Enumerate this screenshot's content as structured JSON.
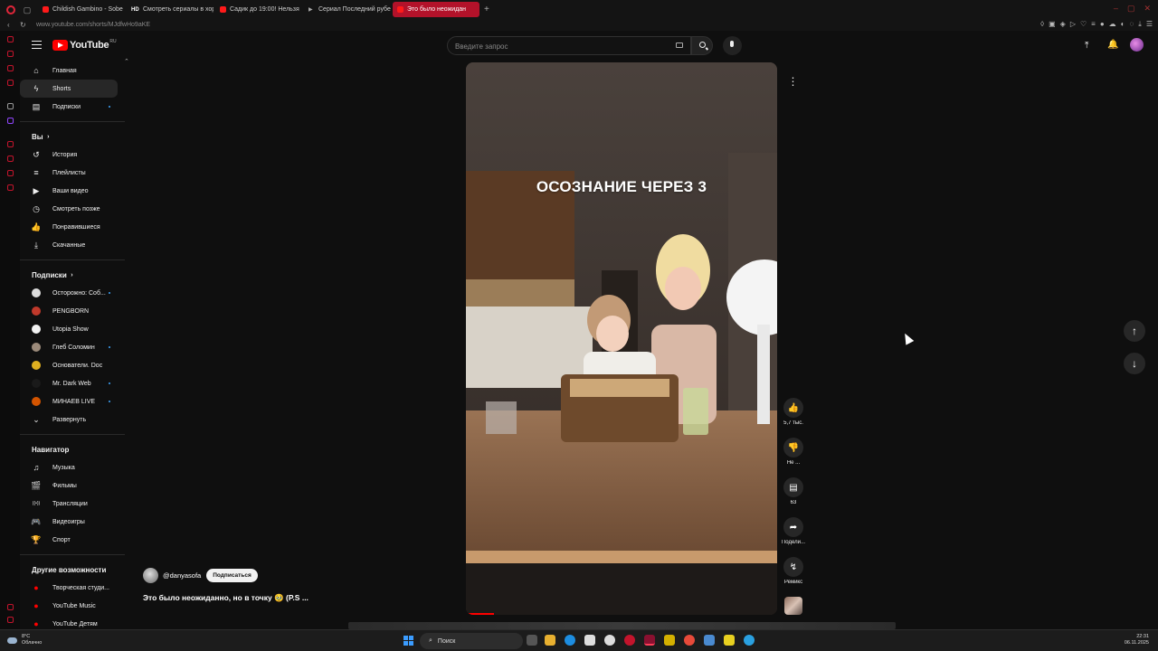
{
  "browser": {
    "tabs": [
      {
        "label": "Childish Gambino - Sobe",
        "fav": "yt"
      },
      {
        "label": "Смотреть сериалы в хор",
        "fav": "hd"
      },
      {
        "label": "Садик до 19:00! Нельзя",
        "fav": "yt"
      },
      {
        "label": "Сериал Последний рубе",
        "fav": "p"
      },
      {
        "label": "Это было неожидан",
        "fav": "yt",
        "active": true
      }
    ],
    "url": "www.youtube.com/shorts/MJdfwHo9aKE"
  },
  "header": {
    "logo_text": "YouTube",
    "logo_region": "RU",
    "search_placeholder": "Введите запрос"
  },
  "sidebar": {
    "main": [
      {
        "label": "Главная",
        "icon": "home-icon",
        "glyph": "⌂"
      },
      {
        "label": "Shorts",
        "icon": "shorts-icon",
        "glyph": "ϟ",
        "active": true
      },
      {
        "label": "Подписки",
        "icon": "subscriptions-icon",
        "glyph": "▤",
        "dot": true
      }
    ],
    "you_heading": "Вы",
    "you": [
      {
        "label": "История",
        "icon": "history-icon",
        "glyph": "↺"
      },
      {
        "label": "Плейлисты",
        "icon": "playlists-icon",
        "glyph": "≡"
      },
      {
        "label": "Ваши видео",
        "icon": "your-videos-icon",
        "glyph": "▶"
      },
      {
        "label": "Смотреть позже",
        "icon": "watch-later-icon",
        "glyph": "◷"
      },
      {
        "label": "Понравившиеся",
        "icon": "liked-icon",
        "glyph": "👍"
      },
      {
        "label": "Скачанные",
        "icon": "downloads-icon",
        "glyph": "⤓"
      }
    ],
    "subs_heading": "Подписки",
    "subs": [
      {
        "label": "Осторожно: Соб...",
        "color": "#dddddd",
        "dot": true
      },
      {
        "label": "PENGBORN",
        "color": "#c0392b",
        "dot": false
      },
      {
        "label": "Utopia Show",
        "color": "#f2f2f2",
        "dot": false
      },
      {
        "label": "Глеб Соломин",
        "color": "#9b8a7a",
        "dot": true
      },
      {
        "label": "Основатели. Doc",
        "color": "#e0b020",
        "dot": false
      },
      {
        "label": "Mr. Dark Web",
        "color": "#1a1a1a",
        "dot": true
      },
      {
        "label": "МИНАЕВ LIVE",
        "color": "#d35400",
        "dot": true
      }
    ],
    "expand_label": "Развернуть",
    "nav_heading": "Навигатор",
    "nav": [
      {
        "label": "Музыка",
        "icon": "music-icon",
        "glyph": "♫"
      },
      {
        "label": "Фильмы",
        "icon": "movies-icon",
        "glyph": "🎬"
      },
      {
        "label": "Трансляции",
        "icon": "live-icon",
        "glyph": "((•))"
      },
      {
        "label": "Видеоигры",
        "icon": "gaming-icon",
        "glyph": "🎮"
      },
      {
        "label": "Спорт",
        "icon": "sport-icon",
        "glyph": "🏆"
      }
    ],
    "more_heading": "Другие возможности",
    "more": [
      {
        "label": "Творческая студи...",
        "icon": "studio-icon"
      },
      {
        "label": "YouTube Music",
        "icon": "yt-music-icon"
      },
      {
        "label": "YouTube Детям",
        "icon": "yt-kids-icon"
      }
    ]
  },
  "short": {
    "overlay_text": "ОСОЗНАНИЕ ЧЕРЕЗ 3",
    "channel": "@danyasofa",
    "subscribe_label": "Подписаться",
    "title": "Это было неожиданно, но в точку 🥹 (P.S ...",
    "progress": 0.09,
    "actions": {
      "likes": "5,7 тыс.",
      "dislike": "Не ...",
      "comments": "63",
      "share": "Подели...",
      "remix": "Ремикс"
    }
  },
  "taskbar": {
    "weather_temp": "8°C",
    "weather_desc": "Облачно",
    "search_label": "Поиск",
    "time": "22:31",
    "date": "06.11.2025"
  },
  "colors": {
    "accent": "#ff0000",
    "browser_active_tab": "#b3122a",
    "link_dot": "#3ea6ff"
  }
}
